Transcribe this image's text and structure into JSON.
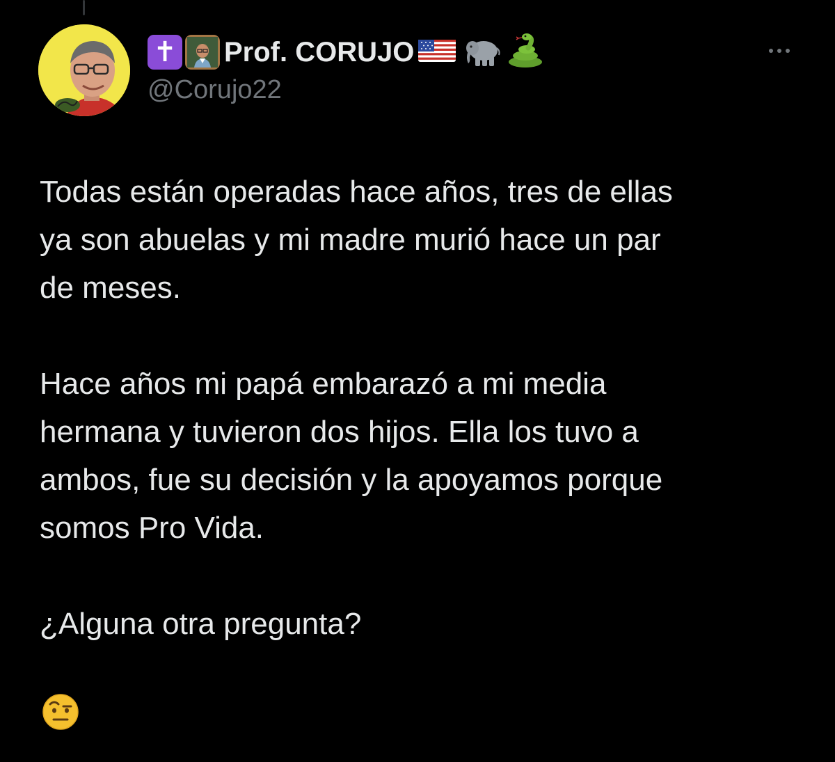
{
  "tweet": {
    "author": {
      "display_name": "Prof. CORUJO",
      "name_emojis": [
        "cross-icon",
        "teacher-icon",
        "us-flag-icon",
        "elephant-icon",
        "snake-icon"
      ],
      "handle": "@Corujo22",
      "avatar_background": "#f2e64a"
    },
    "paragraphs": [
      "Todas están operadas hace años, tres de ellas\nya son abuelas y mi madre murió hace un par\nde meses.",
      "Hace años mi papá embarazó a mi media\nhermana y tuvieron dos hijos. Ella los tuvo a\nambos, fue su decisión y la apoyamos porque\nsomos Pro Vida.",
      "¿Alguna otra pregunta?"
    ],
    "closing_emoji": "face-with-raised-eyebrow-icon"
  },
  "colors": {
    "background": "#000000",
    "text": "#e7e9ea",
    "secondary_text": "#71767b",
    "cross_badge": "#8a4cd8"
  }
}
